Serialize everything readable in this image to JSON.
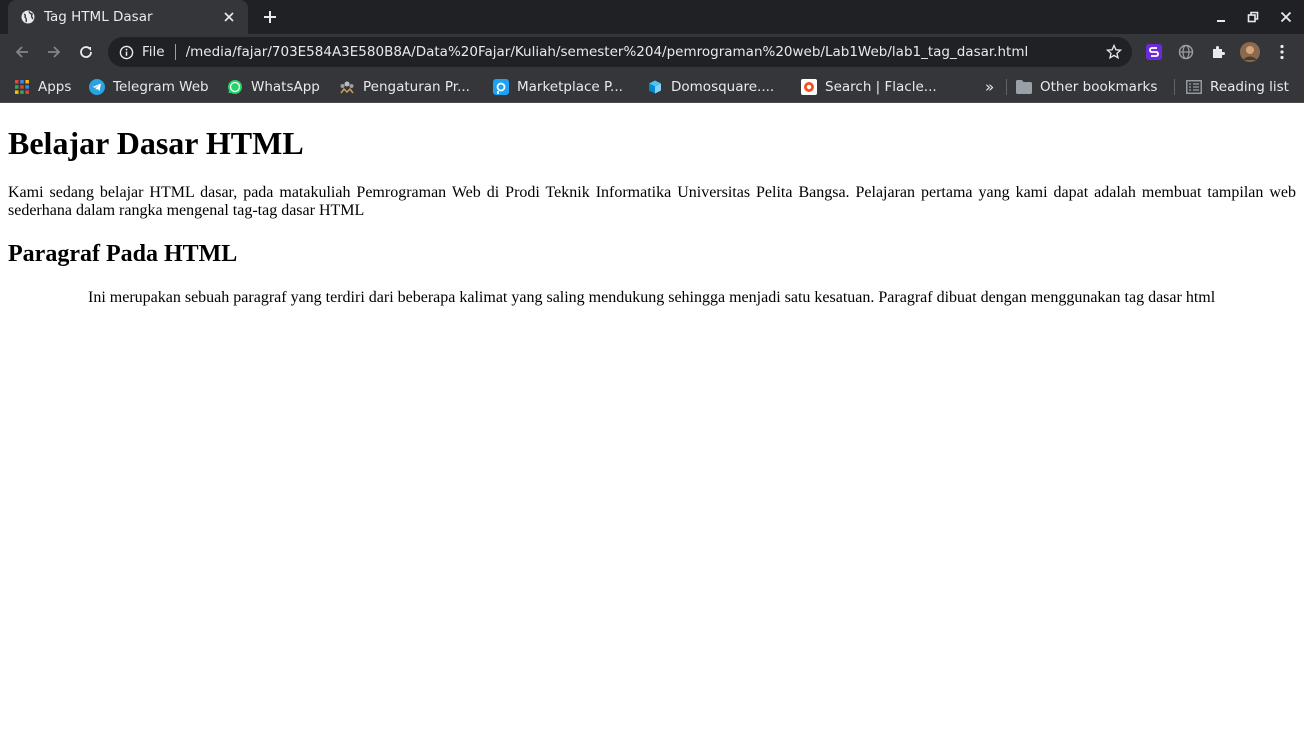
{
  "tab": {
    "title": "Tag HTML Dasar",
    "favicon": "globe-icon"
  },
  "omnibox": {
    "scheme_label": "File",
    "url": "/media/fajar/703E584A3E580B8A/Data%20Fajar/Kuliah/semester%204/pemrograman%20web/Lab1Web/lab1_tag_dasar.html"
  },
  "bookmarks": {
    "items": [
      {
        "label": "Apps",
        "icon": "apps-grid-icon"
      },
      {
        "label": "Telegram Web",
        "icon": "telegram-icon"
      },
      {
        "label": "WhatsApp",
        "icon": "whatsapp-icon"
      },
      {
        "label": "Pengaturan Pr...",
        "icon": "gear-people-icon"
      },
      {
        "label": "Marketplace P...",
        "icon": "marketplace-icon"
      },
      {
        "label": "Domosquare....",
        "icon": "cube-icon"
      },
      {
        "label": "Search | Flacle...",
        "icon": "flacle-icon"
      }
    ],
    "overflow": "»",
    "other": "Other bookmarks",
    "reading_list": "Reading list"
  },
  "content": {
    "h1": "Belajar Dasar HTML",
    "intro": "Kami sedang belajar HTML dasar, pada matakuliah Pemrograman Web di Prodi Teknik Informatika Universitas Pelita Bangsa. Pelajaran pertama yang kami dapat adalah membuat tampilan web sederhana dalam rangka mengenal tag-tag dasar HTML",
    "h2": "Paragraf Pada HTML",
    "paragraph": "Ini merupakan sebuah paragraf yang terdiri dari beberapa kalimat yang saling mendukung sehingga menjadi satu kesatuan. Paragraf dibuat dengan menggunakan tag dasar html"
  },
  "colors": {
    "tabstrip": "#202124",
    "toolbar": "#35363a",
    "omnibox": "#202124",
    "chrome_text": "#e8eaed"
  }
}
